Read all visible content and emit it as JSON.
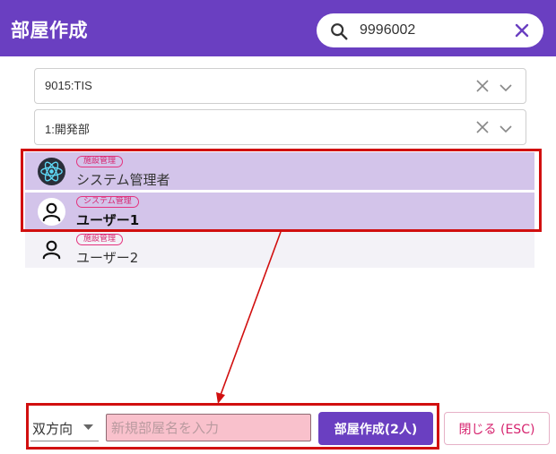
{
  "header": {
    "title": "部屋作成",
    "search": {
      "value": "9996002",
      "icon": "search-icon",
      "clear_icon": "close-icon"
    }
  },
  "filters": {
    "organization": {
      "value": "9015:TIS"
    },
    "department": {
      "value": "1:開発部"
    }
  },
  "users": [
    {
      "badge": "施設管理",
      "name": "システム管理者",
      "selected": true,
      "avatar": "react-atom-logo"
    },
    {
      "badge": "システム管理",
      "name": "ユーザー1",
      "selected": true,
      "avatar": "person-icon"
    },
    {
      "badge": "施設管理",
      "name": "ユーザー2",
      "selected": false,
      "avatar": "person-icon"
    }
  ],
  "footer": {
    "direction": "双方向",
    "room_name_placeholder": "新規部屋名を入力",
    "create_button": "部屋作成(2人)",
    "close_button": "閉じる (ESC)"
  },
  "colors": {
    "brand": "#6a3fc1",
    "selected_row": "#d3c4ea",
    "badge": "#e5337e",
    "callout": "#d10f0f",
    "input_error_bg": "#f9c1cc"
  }
}
